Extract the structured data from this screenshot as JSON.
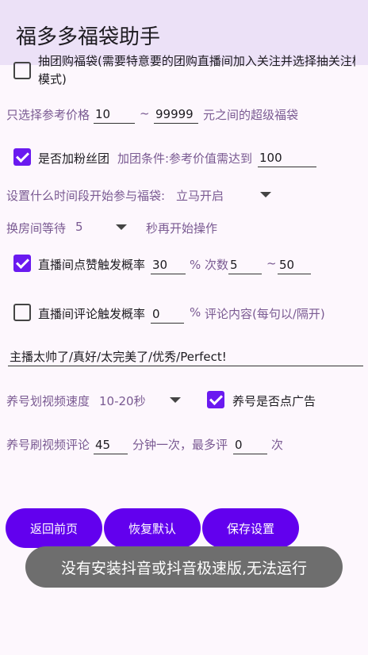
{
  "app": {
    "title": "福多多福袋助手"
  },
  "top_option": {
    "label": "抽团购福袋(需要特意要的团购直播间加入关注并选择抽关注模式)",
    "label_line2": "模式)"
  },
  "price_filter": {
    "prefix": "只选择参考价格",
    "min": "10",
    "separator": "~",
    "max": "99999",
    "suffix": "元之间的超级福袋"
  },
  "fan_group": {
    "label": "是否加粉丝团",
    "condition": "加团条件:参考价值需达到",
    "value": "100"
  },
  "time_setting": {
    "label": "设置什么时间段开始参与福袋:",
    "selected": "立马开启"
  },
  "room_wait": {
    "label": "换房间等待",
    "selected": "5",
    "suffix": "秒再开始操作"
  },
  "like_trigger": {
    "label": "直播间点赞触发概率",
    "probability": "30",
    "unit": "% 次数",
    "count_min": "5",
    "range_sep": "~",
    "count_max": "50"
  },
  "comment_trigger": {
    "label": "直播间评论触发概率",
    "probability": "0",
    "unit": "%",
    "content_label": "评论内容(每句以/隔开)"
  },
  "comment_content": {
    "value": "主播太帅了/真好/太完美了/优秀/Perfect!"
  },
  "video_speed": {
    "label": "养号划视频速度",
    "selected": "10-20秒",
    "ad_label": "养号是否点广告"
  },
  "video_comment": {
    "label": "养号刷视频评论",
    "minutes": "45",
    "mid": "分钟一次，最多评",
    "max": "0",
    "suffix": "次"
  },
  "buttons": {
    "back": "返回前页",
    "restore": "恢复默认",
    "save": "保存设置"
  },
  "toast": {
    "message": "没有安装抖音或抖音极速版,无法运行"
  },
  "colors": {
    "accent": "#6200ee",
    "checkbox": "#6a1af0",
    "appbar": "#ece1f7",
    "label": "#7a5a92"
  }
}
